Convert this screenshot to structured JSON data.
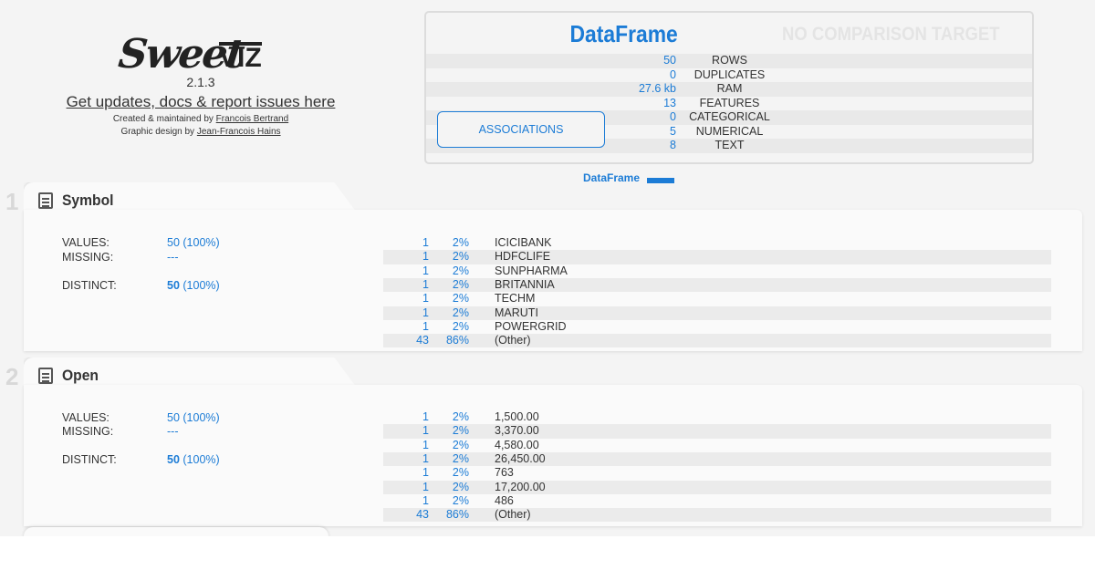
{
  "header": {
    "logo_main": "Sweet",
    "logo_suffix": "VIZ",
    "version": "2.1.3",
    "updates_link": "Get updates, docs & report issues here",
    "created_prefix": "Created & maintained by ",
    "created_author": "Francois Bertrand",
    "design_prefix": "Graphic design by ",
    "design_author": "Jean-Francois Hains"
  },
  "summary": {
    "title": "DataFrame",
    "no_compare": "NO COMPARISON TARGET",
    "associations_button": "ASSOCIATIONS",
    "rows": [
      {
        "value": "50",
        "label": "ROWS"
      },
      {
        "value": "0",
        "label": "DUPLICATES"
      },
      {
        "value": "27.6 kb",
        "label": "RAM"
      },
      {
        "value": "13",
        "label": "FEATURES"
      },
      {
        "value": "0",
        "label": "CATEGORICAL"
      },
      {
        "value": "5",
        "label": "NUMERICAL"
      },
      {
        "value": "8",
        "label": "TEXT"
      }
    ],
    "legend_label": "DataFrame",
    "legend_color": "#1c7cd6"
  },
  "features": [
    {
      "number": "1",
      "name": "Symbol",
      "values_label": "VALUES:",
      "values_value": "50 (100%)",
      "missing_label": "MISSING:",
      "missing_value": "---",
      "distinct_label": "DISTINCT:",
      "distinct_count": "50",
      "distinct_pct": "(100%)",
      "freq": [
        {
          "count": "1",
          "pct": "2%",
          "value": "ICICIBANK"
        },
        {
          "count": "1",
          "pct": "2%",
          "value": "HDFCLIFE"
        },
        {
          "count": "1",
          "pct": "2%",
          "value": "SUNPHARMA"
        },
        {
          "count": "1",
          "pct": "2%",
          "value": "BRITANNIA"
        },
        {
          "count": "1",
          "pct": "2%",
          "value": "TECHM"
        },
        {
          "count": "1",
          "pct": "2%",
          "value": "MARUTI"
        },
        {
          "count": "1",
          "pct": "2%",
          "value": "POWERGRID"
        },
        {
          "count": "43",
          "pct": "86%",
          "value": "(Other)"
        }
      ]
    },
    {
      "number": "2",
      "name": "Open",
      "values_label": "VALUES:",
      "values_value": "50 (100%)",
      "missing_label": "MISSING:",
      "missing_value": "---",
      "distinct_label": "DISTINCT:",
      "distinct_count": "50",
      "distinct_pct": "(100%)",
      "freq": [
        {
          "count": "1",
          "pct": "2%",
          "value": "1,500.00"
        },
        {
          "count": "1",
          "pct": "2%",
          "value": "3,370.00"
        },
        {
          "count": "1",
          "pct": "2%",
          "value": "4,580.00"
        },
        {
          "count": "1",
          "pct": "2%",
          "value": "26,450.00"
        },
        {
          "count": "1",
          "pct": "2%",
          "value": "763"
        },
        {
          "count": "1",
          "pct": "2%",
          "value": "17,200.00"
        },
        {
          "count": "1",
          "pct": "2%",
          "value": "486"
        },
        {
          "count": "43",
          "pct": "86%",
          "value": "(Other)"
        }
      ]
    }
  ]
}
